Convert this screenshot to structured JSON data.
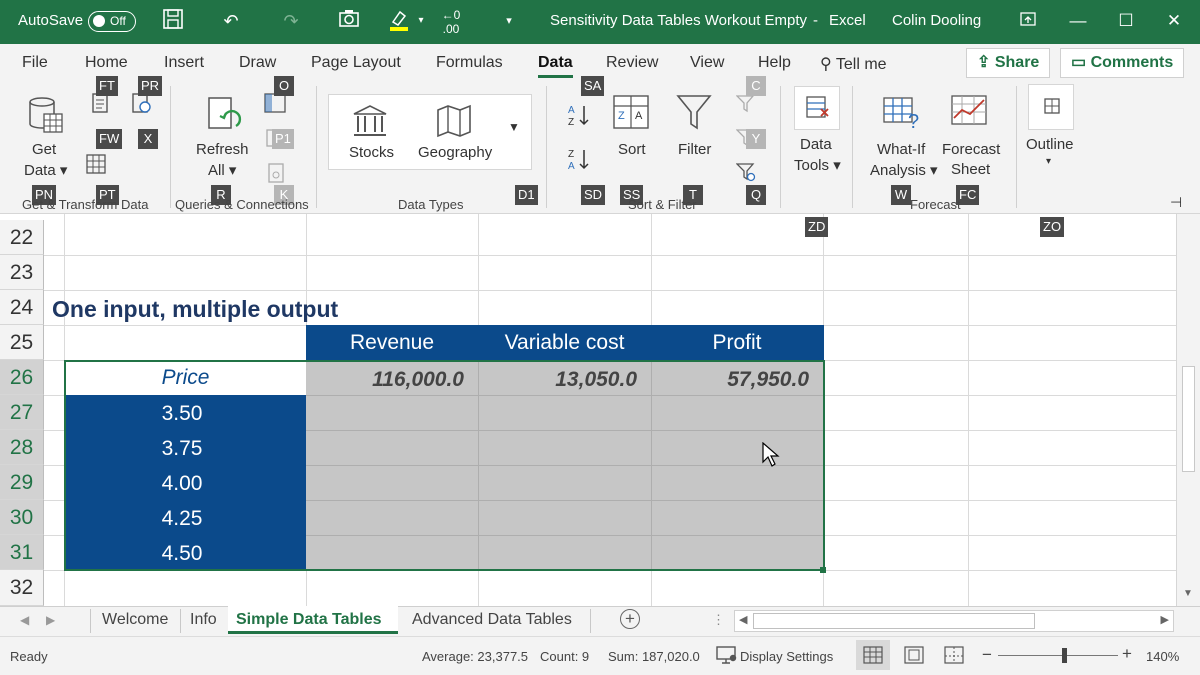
{
  "titlebar": {
    "autosave_label": "AutoSave",
    "autosave_state": "Off",
    "doc_title": "Sensitivity Data Tables Workout Empty",
    "separator": "-",
    "app_name": "Excel",
    "user_name": "Colin Dooling"
  },
  "tabs": [
    "File",
    "Home",
    "Insert",
    "Draw",
    "Page Layout",
    "Formulas",
    "Data",
    "Review",
    "View",
    "Help"
  ],
  "active_tab": "Data",
  "tell_me": "Tell me",
  "share_label": "Share",
  "comments_label": "Comments",
  "ribbon": {
    "get_data_1": "Get",
    "get_data_2": "Data",
    "refresh_1": "Refresh",
    "refresh_2": "All",
    "stocks": "Stocks",
    "geography": "Geography",
    "sort": "Sort",
    "filter": "Filter",
    "data_tools_1": "Data",
    "data_tools_2": "Tools",
    "whatif_1": "What-If",
    "whatif_2": "Analysis",
    "forecast_1": "Forecast",
    "forecast_2": "Sheet",
    "outline": "Outline",
    "groups": {
      "get_transform": "Get & Transform Data",
      "queries": "Queries & Connections",
      "data_types": "Data Types",
      "sort_filter": "Sort & Filter",
      "forecast": "Forecast"
    }
  },
  "keytips": {
    "ft": "FT",
    "pr": "PR",
    "o": "O",
    "sa": "SA",
    "c": "C",
    "fw": "FW",
    "x": "X",
    "p1": "P1",
    "y": "Y",
    "pn": "PN",
    "pt": "PT",
    "r": "R",
    "k": "K",
    "d1": "D1",
    "sd": "SD",
    "ss": "SS",
    "t": "T",
    "q": "Q",
    "w": "W",
    "fc": "FC",
    "zd": "ZD",
    "zo": "ZO"
  },
  "rows": [
    "22",
    "23",
    "24",
    "25",
    "26",
    "27",
    "28",
    "29",
    "30",
    "31",
    "32"
  ],
  "sheet": {
    "heading": "One input, multiple output",
    "col_headers": [
      "Revenue",
      "Variable cost",
      "Profit"
    ],
    "input_label": "Price",
    "outputs": [
      "116,000.0",
      "13,050.0",
      "57,950.0"
    ],
    "prices": [
      "3.50",
      "3.75",
      "4.00",
      "4.25",
      "4.50"
    ]
  },
  "sheet_tabs": [
    "Welcome",
    "Info",
    "Simple Data Tables",
    "Advanced Data Tables"
  ],
  "active_sheet": "Simple Data Tables",
  "status": {
    "ready": "Ready",
    "average": "Average: 23,377.5",
    "count": "Count: 9",
    "sum": "Sum: 187,020.0",
    "display_settings": "Display Settings",
    "zoom": "140%"
  },
  "colors": {
    "excel_green": "#217346",
    "header_blue": "#0b4a8b",
    "heading_navy": "#1f3864",
    "output_gray": "#c6c6c6"
  }
}
